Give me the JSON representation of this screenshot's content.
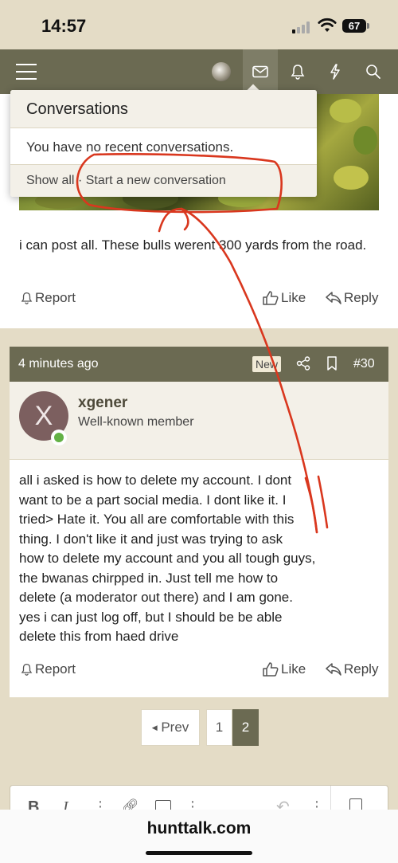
{
  "status_bar": {
    "time": "14:57",
    "battery": "67"
  },
  "site": {
    "url": "hunttalk.com"
  },
  "conversations_popup": {
    "title": "Conversations",
    "empty_message": "You have no recent conversations.",
    "show_all": "Show all",
    "separator": "·",
    "start_new": "Start a new conversation"
  },
  "posts": [
    {
      "text": "i can post all. These bulls werent 300 yards from the road.",
      "report": "Report",
      "like": "Like",
      "reply": "Reply"
    },
    {
      "time": "4 minutes ago",
      "badge": "New",
      "post_number": "#30",
      "author_initial": "X",
      "author": "xgener",
      "author_title": "Well-known member",
      "text_lines": [
        "all i asked is how to delete my account. I dont",
        "want to be a part social media. I dont like it. I",
        "tried> Hate it. You all are comfortable with this",
        "thing. I don't like it and just was trying to ask",
        "how to delete my account and you all tough guys,",
        "the bwanas chirpped in. Just tell me how to",
        "delete (a moderator out there) and I am gone.",
        "yes i can just log off, but I should be be able",
        "delete this from haed drive"
      ],
      "report": "Report",
      "like": "Like",
      "reply": "Reply"
    }
  ],
  "pagination": {
    "prev": "Prev",
    "pages": [
      "1",
      "2"
    ],
    "current": "2"
  },
  "colors": {
    "brand": "#6b6a52",
    "background": "#e4dcc6",
    "annotation": "#d9371e"
  }
}
